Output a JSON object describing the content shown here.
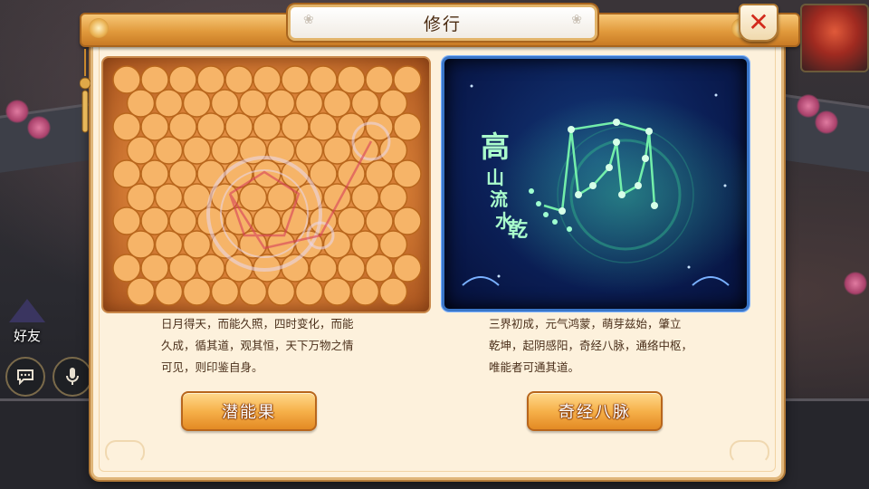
{
  "dialog": {
    "title": "修行",
    "close_icon": "close-icon"
  },
  "left_card": {
    "art": "potential-fruit-honeycomb-art",
    "description_lines": [
      "日月得天，而能久照，四时变化，而能",
      "久成，循其道，观其恒，天下万物之情",
      "可见，则印鉴自身。"
    ],
    "button_label": "潜能果"
  },
  "right_card": {
    "art": "meridian-constellation-art",
    "calligraphy_chars": [
      "高",
      "山",
      "流",
      "水",
      "乾"
    ],
    "description_lines": [
      "三界初成，元气鸿蒙，萌芽兹始，肇立",
      "乾坤，起阴感阳，奇经八脉，通络中枢，",
      "唯能者可通其道。"
    ],
    "button_label": "奇经八脉"
  },
  "hud": {
    "friend_label": "好友",
    "chat_icon": "chat-bubble-icon",
    "mic_icon": "microphone-icon",
    "avatar": "player-avatar"
  },
  "colors": {
    "dialog_bg": "#fdf1dc",
    "frame_gold": "#e19a3c",
    "button_orange": "#f6b14a",
    "close_red": "#d22a1c",
    "left_panel": "#d77e36",
    "right_panel": "#0b1f56",
    "constellation_green": "#7dffb0"
  }
}
